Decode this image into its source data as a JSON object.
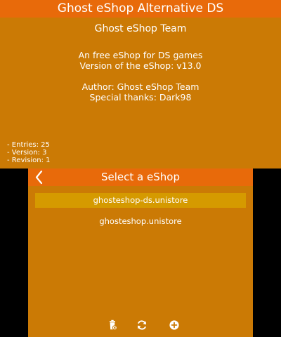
{
  "top_screen": {
    "header_title": "Ghost eShop Alternative DS",
    "store_title": "Ghost eShop Team",
    "description": "An free eShop for DS games",
    "version_line": "Version of the eShop: v13.0",
    "author_line": "Author: Ghost eShop Team",
    "thanks_line": "Special thanks: Dark98",
    "stats": {
      "entries": "- Entries: 25",
      "version": "- Version: 3",
      "revision": "- Revision: 1"
    }
  },
  "bottom_screen": {
    "header_title": "Select a eShop",
    "stores": [
      {
        "name": "ghosteshop-ds.unistore",
        "selected": true
      },
      {
        "name": "ghosteshop.unistore",
        "selected": false
      }
    ],
    "icons": {
      "back": "chevron-left-icon",
      "delete": "trash-icon",
      "refresh": "refresh-icon",
      "add": "plus-circle-icon"
    }
  },
  "colors": {
    "header": "#e86a0a",
    "background": "#cb7a05",
    "selected_row": "#d59a00",
    "text": "#ffffff"
  }
}
